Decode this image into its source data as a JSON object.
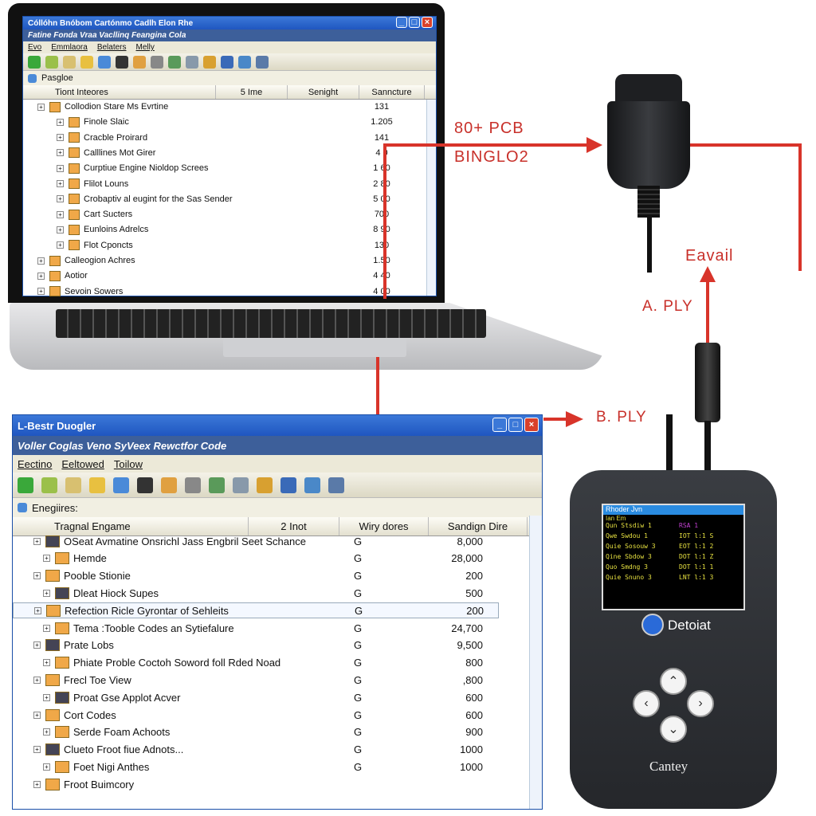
{
  "laptop_window": {
    "title": "Cóllóhn Bnóbom Cartónmo Cadlh Elon Rhe",
    "menubar": "Fatine Fonda Vraa Vacllinq Feangina Cola",
    "menu": [
      "Evo",
      "Emmlaora",
      "Belaters",
      "Melly"
    ],
    "panel_label": "Pasgloe",
    "columns": [
      "Tiont Inteores",
      "5 Ime",
      "Senight",
      "Sanncture"
    ],
    "rows": [
      {
        "name": "Collodion Stare Ms Evrtine",
        "value": "131"
      },
      {
        "name": "Finole Slaic",
        "value": "1.205"
      },
      {
        "name": "Cracble Proirard",
        "value": "141"
      },
      {
        "name": "Calllines Mot Girer",
        "value": "4 0"
      },
      {
        "name": "Curptiue Engine Nioldop Screes",
        "value": "1 60"
      },
      {
        "name": "Flilot Louns",
        "value": "2 80"
      },
      {
        "name": "Crobaptiv al eugint for the Sas Sender",
        "value": "5 00"
      },
      {
        "name": "Cart Sucters",
        "value": "700"
      },
      {
        "name": "Eunloins Adrelcs",
        "value": "8 90"
      },
      {
        "name": "Flot Cponcts",
        "value": "130"
      },
      {
        "name": "Calleogion Achres",
        "value": "1.50"
      },
      {
        "name": "Aotior",
        "value": "4 40"
      },
      {
        "name": "Sevoin Sowers",
        "value": "4 00"
      }
    ]
  },
  "labels": {
    "pcb": "80+ PCB",
    "bingo": "BINGLO2",
    "eavail": "Eavail",
    "a_ply": "A. PLY",
    "b_ply": "B. PLY"
  },
  "scanner_window": {
    "title": "L-Bestr Duogler",
    "menubar": "Voller Coglas Veno SyVeex Rewctfor Code",
    "menu": [
      "Eectino",
      "Eeltowed",
      "Toilow"
    ],
    "panel_label": "Enegiires:",
    "columns": [
      "Tragnal Engame",
      "2 Inot",
      "Wiry dores",
      "Sandign Dire"
    ],
    "rows": [
      {
        "name": "OSeat Avmatine Onsrichl Jass Engbril Seet Schance",
        "col": "G",
        "value": "8,000"
      },
      {
        "name": "Hemde",
        "col": "G",
        "value": "28,000"
      },
      {
        "name": "Pooble Stionie",
        "col": "G",
        "value": "200"
      },
      {
        "name": "Dleat Hiock Supes",
        "col": "G",
        "value": "500"
      },
      {
        "name": "Refection Ricle Gyrontar of Sehleits",
        "col": "G",
        "value": "200"
      },
      {
        "name": "Tema :Tooble Codes an Sytiefalure",
        "col": "G",
        "value": "24,700"
      },
      {
        "name": "Prate Lobs",
        "col": "G",
        "value": "9,500"
      },
      {
        "name": "Phiate Proble Coctoh Soword foll Rded Noad",
        "col": "G",
        "value": "800"
      },
      {
        "name": "Frecl Toe View",
        "col": "G",
        "value": ",800"
      },
      {
        "name": "Proat Gse Applot Acver",
        "col": "G",
        "value": "600"
      },
      {
        "name": "Cort Codes",
        "col": "G",
        "value": "600"
      },
      {
        "name": "Serde Foam Achoots",
        "col": "G",
        "value": "900"
      },
      {
        "name": "Clueto Froot fiue Adnots...",
        "col": "G",
        "value": "1000"
      },
      {
        "name": "Foet Nigi Anthes",
        "col": "G",
        "value": "1000"
      },
      {
        "name": "Froot Buimcory",
        "col": "",
        "value": ""
      }
    ]
  },
  "scanner": {
    "screen_title": "Rhoder Jvn",
    "screen_sub": "Ian Em",
    "screen_rows": [
      {
        "a": "Qun Stsdiw 1",
        "b": "RSA    1"
      },
      {
        "a": "Qwe Swdou 1",
        "b": "IOT l:1 S"
      },
      {
        "a": "Quie Sosouw 3",
        "b": "EOT l:1 2"
      },
      {
        "a": "Qine Sbdow 3",
        "b": "DOT l:1 Z"
      },
      {
        "a": "Quo Smdng 3",
        "b": "DOT l:1 1"
      },
      {
        "a": "Quie Snuno 3",
        "b": "LNT l:1 3"
      }
    ],
    "brand": "Detoiat",
    "model": "Cantey"
  },
  "colors": {
    "accent_red": "#d8342a",
    "title_blue": "#1f56c0",
    "screen_text": "#e6e040",
    "screen_highlight": "#c040d0"
  }
}
